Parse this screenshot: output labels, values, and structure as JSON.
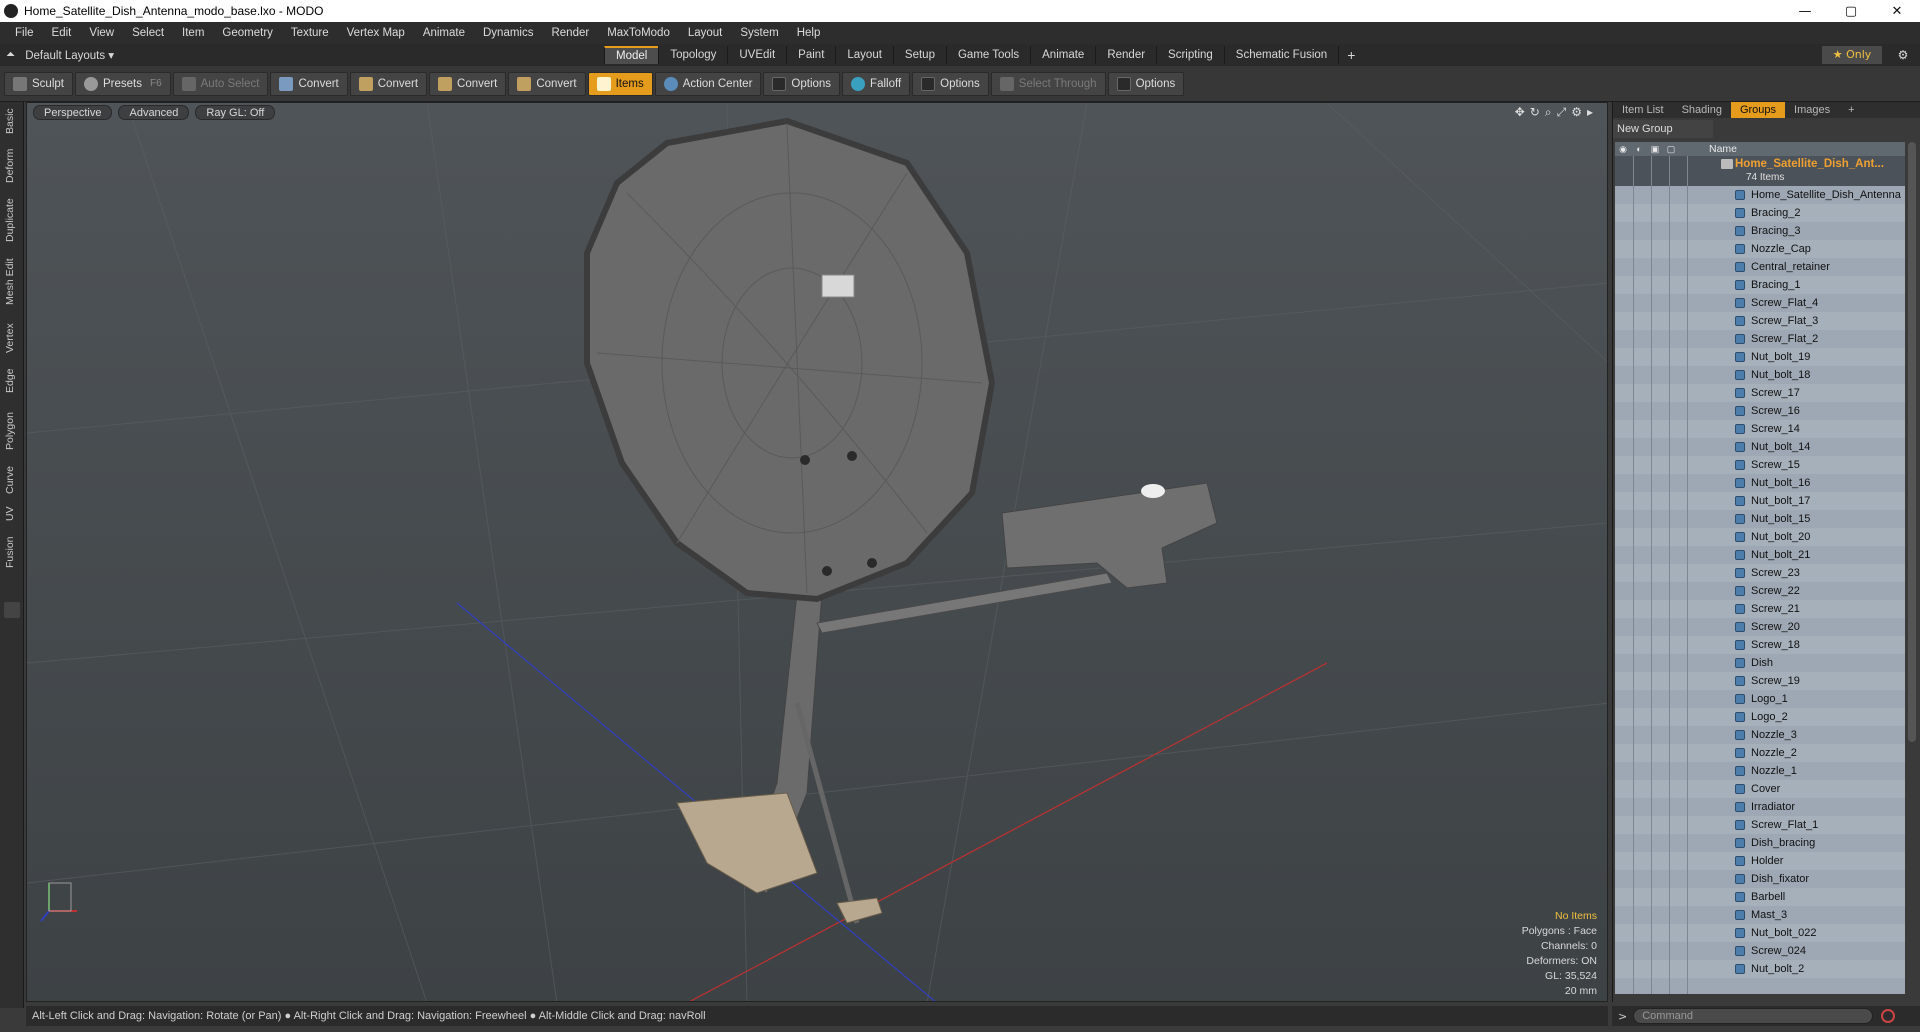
{
  "window": {
    "title": "Home_Satellite_Dish_Antenna_modo_base.lxo - MODO",
    "min": "—",
    "max": "▢",
    "close": "✕"
  },
  "menu": [
    "File",
    "Edit",
    "View",
    "Select",
    "Item",
    "Geometry",
    "Texture",
    "Vertex Map",
    "Animate",
    "Dynamics",
    "Render",
    "MaxToModo",
    "Layout",
    "System",
    "Help"
  ],
  "layoutbar": {
    "default_layouts": "Default Layouts ▾",
    "tabs": [
      "Model",
      "Topology",
      "UVEdit",
      "Paint",
      "Layout",
      "Setup",
      "Game Tools",
      "Animate",
      "Render",
      "Scripting",
      "Schematic Fusion"
    ],
    "active_tab": "Model",
    "plus": "+",
    "only": "★ Only"
  },
  "toolbar": {
    "sculpt": "Sculpt",
    "presets": "Presets",
    "presets_hint": "F6",
    "auto_select": "Auto Select",
    "convert1": "Convert",
    "convert2": "Convert",
    "convert3": "Convert",
    "convert4": "Convert",
    "items": "Items",
    "action_center": "Action Center",
    "options1": "Options",
    "falloff": "Falloff",
    "options2": "Options",
    "select_through": "Select Through",
    "options3": "Options"
  },
  "left_strip": [
    "Basic",
    "Deform",
    "Duplicate",
    "Mesh Edit",
    "Vertex",
    "Edge",
    "Polygon",
    "Curve",
    "UV",
    "Fusion"
  ],
  "viewport": {
    "header": {
      "perspective": "Perspective",
      "advanced": "Advanced",
      "raygl": "Ray GL: Off"
    },
    "stats": {
      "no_items": "No Items",
      "polygons": "Polygons : Face",
      "channels": "Channels: 0",
      "deformers": "Deformers: ON",
      "gl": "GL: 35,524",
      "scale": "20 mm"
    },
    "colors": {
      "bg_top": "#4f5458",
      "bg_bottom": "#3d4245",
      "dish": "#6a6a6a",
      "x_axis": "#c03030",
      "z_axis": "#3040c0"
    }
  },
  "status": "Alt-Left Click and Drag: Navigation: Rotate (or Pan) ● Alt-Right Click and Drag: Navigation: Freewheel ● Alt-Middle Click and Drag: navRoll",
  "right_panel": {
    "tabs": [
      "Item List",
      "Shading",
      "Groups",
      "Images",
      "+"
    ],
    "active_tab": "Groups",
    "new_group": "New Group",
    "header_name": "Name",
    "group": {
      "name": "Home_Satellite_Dish_Ant...",
      "count": "74 Items"
    },
    "items": [
      "Home_Satellite_Dish_Antenna",
      "Bracing_2",
      "Bracing_3",
      "Nozzle_Cap",
      "Central_retainer",
      "Bracing_1",
      "Screw_Flat_4",
      "Screw_Flat_3",
      "Screw_Flat_2",
      "Nut_bolt_19",
      "Nut_bolt_18",
      "Screw_17",
      "Screw_16",
      "Screw_14",
      "Nut_bolt_14",
      "Screw_15",
      "Nut_bolt_16",
      "Nut_bolt_17",
      "Nut_bolt_15",
      "Nut_bolt_20",
      "Nut_bolt_21",
      "Screw_23",
      "Screw_22",
      "Screw_21",
      "Screw_20",
      "Screw_18",
      "Dish",
      "Screw_19",
      "Logo_1",
      "Logo_2",
      "Nozzle_3",
      "Nozzle_2",
      "Nozzle_1",
      "Cover",
      "Irradiator",
      "Screw_Flat_1",
      "Dish_bracing",
      "Holder",
      "Dish_fixator",
      "Barbell",
      "Mast_3",
      "Nut_bolt_022",
      "Screw_024",
      "Nut_bolt_2"
    ]
  },
  "command": {
    "prompt": ">",
    "placeholder": "Command"
  }
}
